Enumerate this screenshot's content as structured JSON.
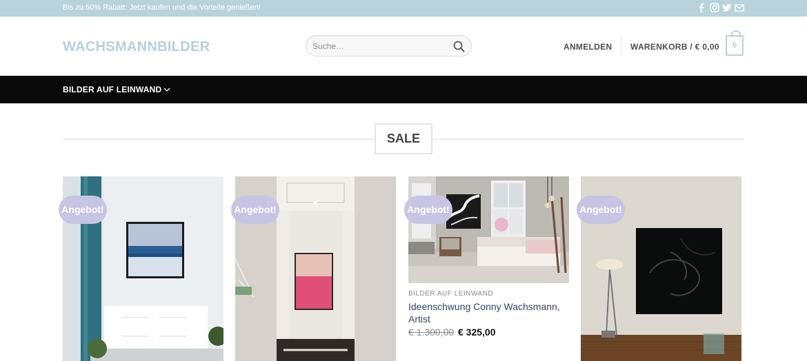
{
  "topbar": {
    "promo_text": "Bis zu 50% Rabatt: Jetzt kaufen und die Vorteile genießen!",
    "social_icons": [
      "facebook-icon",
      "instagram-icon",
      "twitter-icon",
      "email-icon"
    ]
  },
  "header": {
    "logo": "WACHSMANNBILDER",
    "search_placeholder": "Suche…",
    "login_label": "ANMELDEN",
    "cart_label": "WARENKORB / € 0,00",
    "cart_count": "0"
  },
  "nav": {
    "items": [
      {
        "label": "BILDER AUF LEINWAND"
      }
    ]
  },
  "section": {
    "title": "SALE"
  },
  "products": [
    {
      "badge": "Angebot!"
    },
    {
      "badge": "Angebot!"
    },
    {
      "badge": "Angebot!",
      "category": "BILDER AUF LEINWAND",
      "name": "Ideenschwung Conny Wachsmann, Artist",
      "price_old": "€ 1.300,00",
      "price_new": "€ 325,00"
    },
    {
      "badge": "Angebot!"
    }
  ],
  "colors": {
    "topbar_bg": "#b8d3db",
    "logo": "#b6d0d8",
    "nav_bg": "#0a0a0a",
    "badge_bg": "#c8c4e3",
    "product_name": "#334862"
  }
}
